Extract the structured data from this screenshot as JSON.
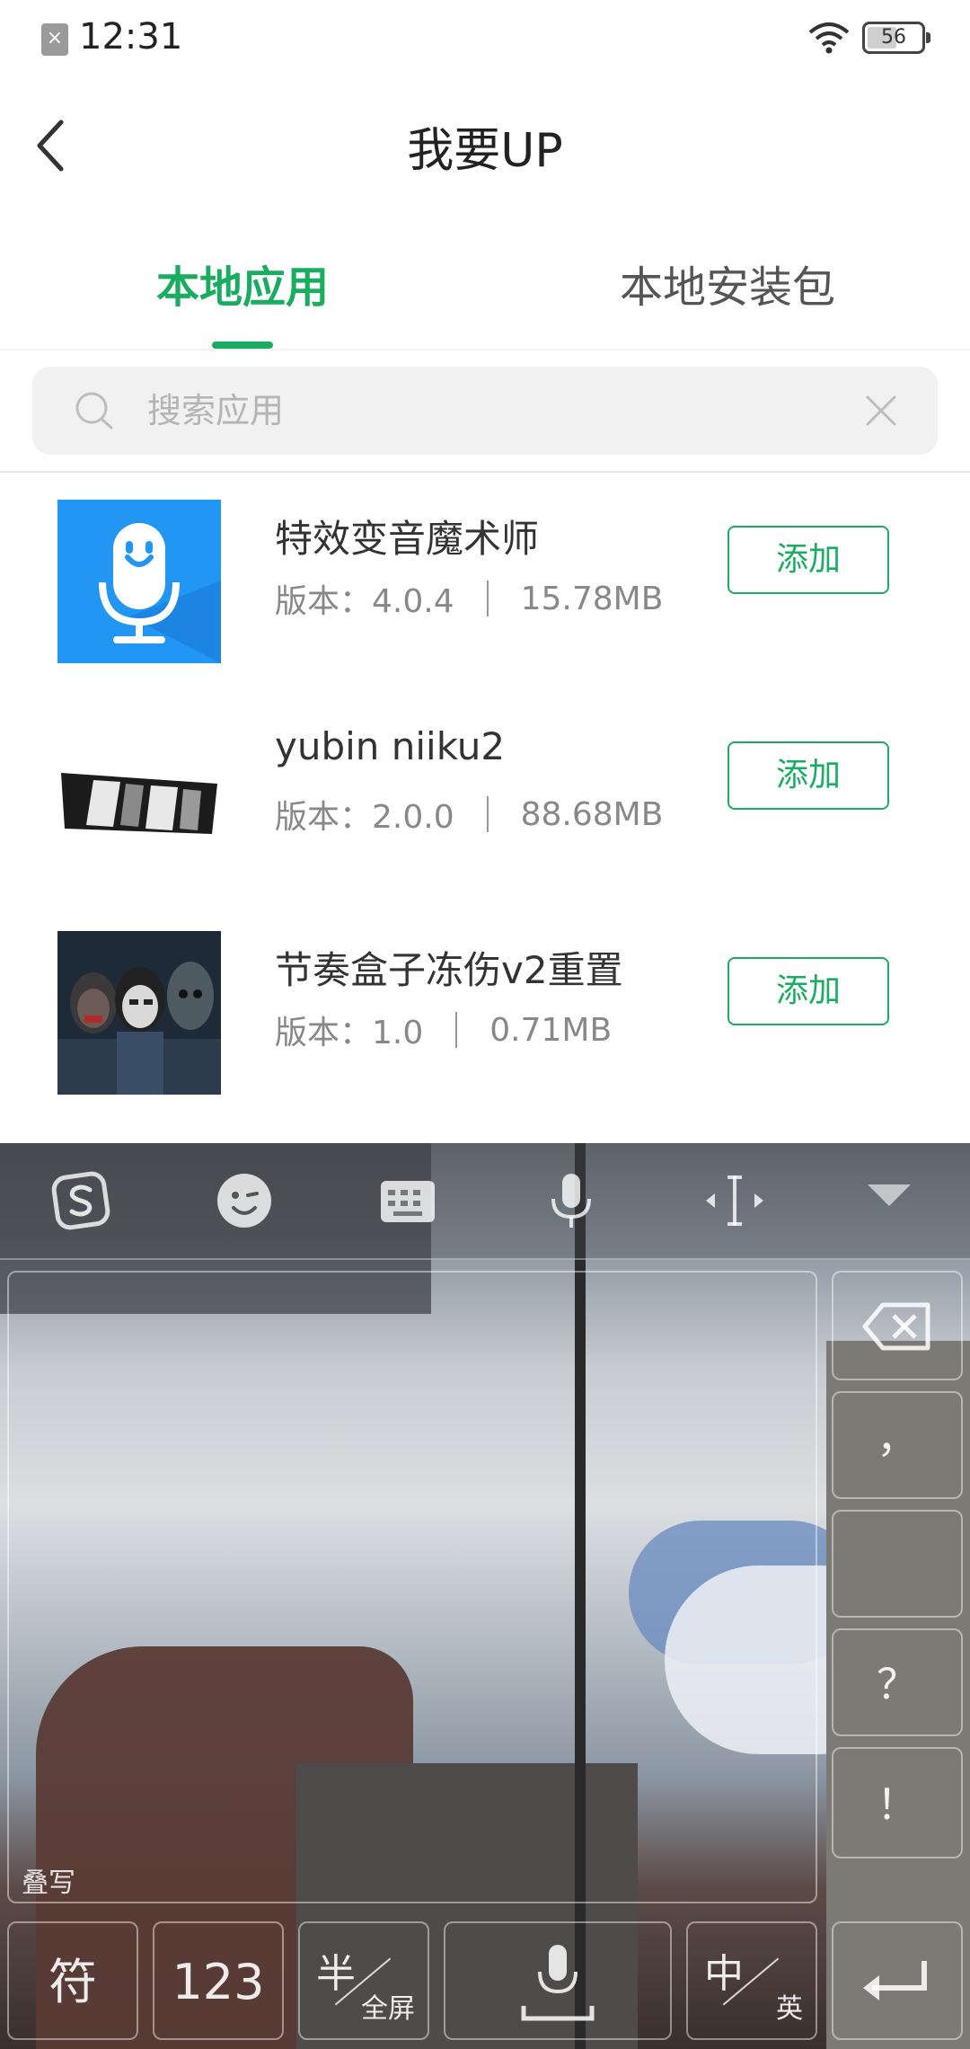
{
  "status_bar": {
    "time": "12:31",
    "battery": "56",
    "battery_level": 0.56
  },
  "header": {
    "title": "我要UP"
  },
  "tabs": [
    {
      "label": "本地应用",
      "active": true
    },
    {
      "label": "本地安装包",
      "active": false
    }
  ],
  "search": {
    "placeholder": "搜索应用",
    "value": ""
  },
  "apps": [
    {
      "name": "特效变音魔术师",
      "version": "版本：4.0.4",
      "size": "15.78MB",
      "add_label": "添加"
    },
    {
      "name": "yubin niiku2",
      "version": "版本：2.0.0",
      "size": "88.68MB",
      "add_label": "添加"
    },
    {
      "name": "节奏盒子冻伤v2重置",
      "version": "版本：1.0",
      "size": "0.71MB",
      "add_label": "添加"
    }
  ],
  "keyboard": {
    "handwrite_label": "叠写",
    "side_keys": [
      "，",
      "？",
      "！"
    ],
    "bottom_keys": {
      "symbols": "符",
      "numbers": "123",
      "half_width": "半",
      "full_width": "全屏",
      "chinese": "中",
      "english": "英"
    }
  },
  "colors": {
    "accent": "#1aad62",
    "app1_icon_bg": "#2196f3"
  }
}
